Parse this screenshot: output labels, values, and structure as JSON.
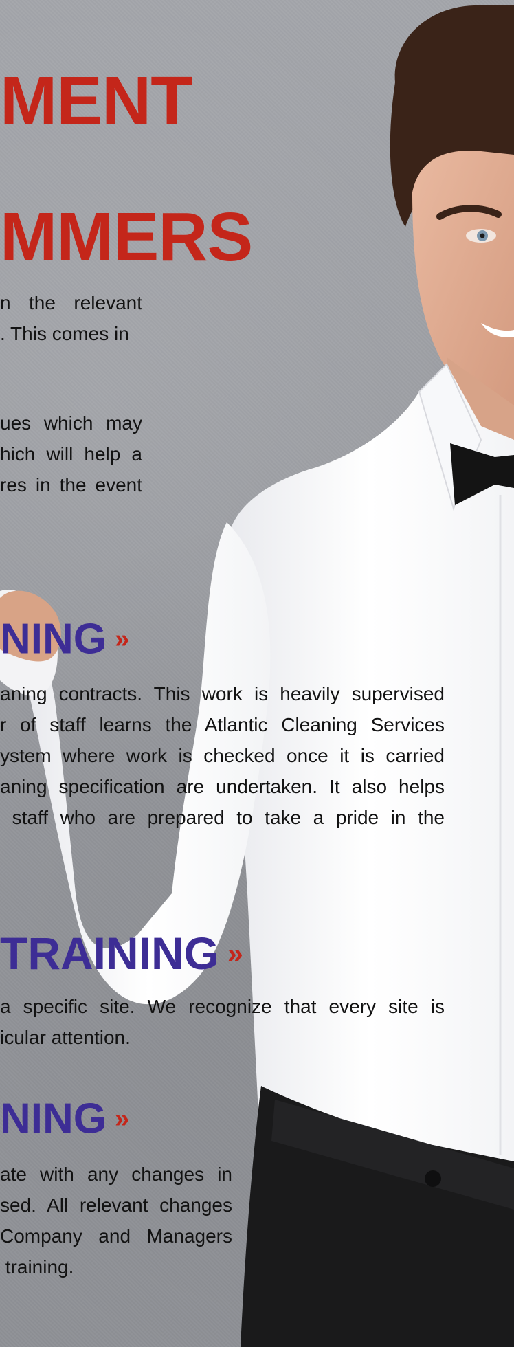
{
  "headings": {
    "management": "MENT",
    "programmers": "MMERS",
    "training1": "NING",
    "training2": "TRAINING",
    "training3": "NING"
  },
  "chevron": "»",
  "paragraphs": {
    "p1": [
      "n the relevant",
      ". This comes in"
    ],
    "p2": [
      "ues which may",
      "hich will help a",
      "res in the event"
    ],
    "p3": [
      "aning contracts. This work is heavily supervised",
      "r of staff learns the Atlantic Cleaning Services",
      "ystem where work is checked once it is carried",
      "aning specification are undertaken. It also helps",
      " staff who are prepared to take a pride in the"
    ],
    "p4": [
      "a specific site. We recognize that every site is",
      "icular attention."
    ],
    "p5": [
      "ate with any changes in",
      "sed. All relevant changes",
      "Company and Managers",
      " training."
    ]
  },
  "colors": {
    "red": "#c4261a",
    "purple": "#3d2d95",
    "text": "#121212"
  }
}
